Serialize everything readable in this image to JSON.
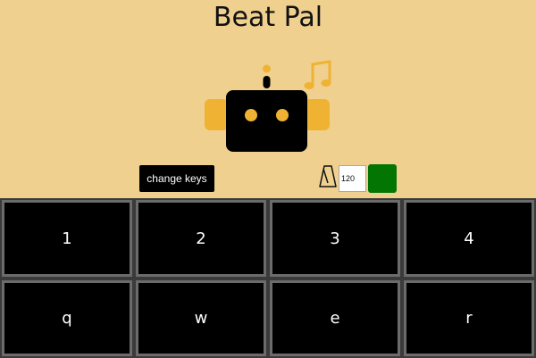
{
  "header": {
    "title": "Beat Pal"
  },
  "controls": {
    "change_keys_label": "change keys",
    "bpm_value": "120"
  },
  "colors": {
    "background": "#efd08f",
    "robot_accent": "#f0b232",
    "play_button": "#037503"
  },
  "pads": [
    {
      "key": "1"
    },
    {
      "key": "2"
    },
    {
      "key": "3"
    },
    {
      "key": "4"
    },
    {
      "key": "q"
    },
    {
      "key": "w"
    },
    {
      "key": "e"
    },
    {
      "key": "r"
    }
  ]
}
